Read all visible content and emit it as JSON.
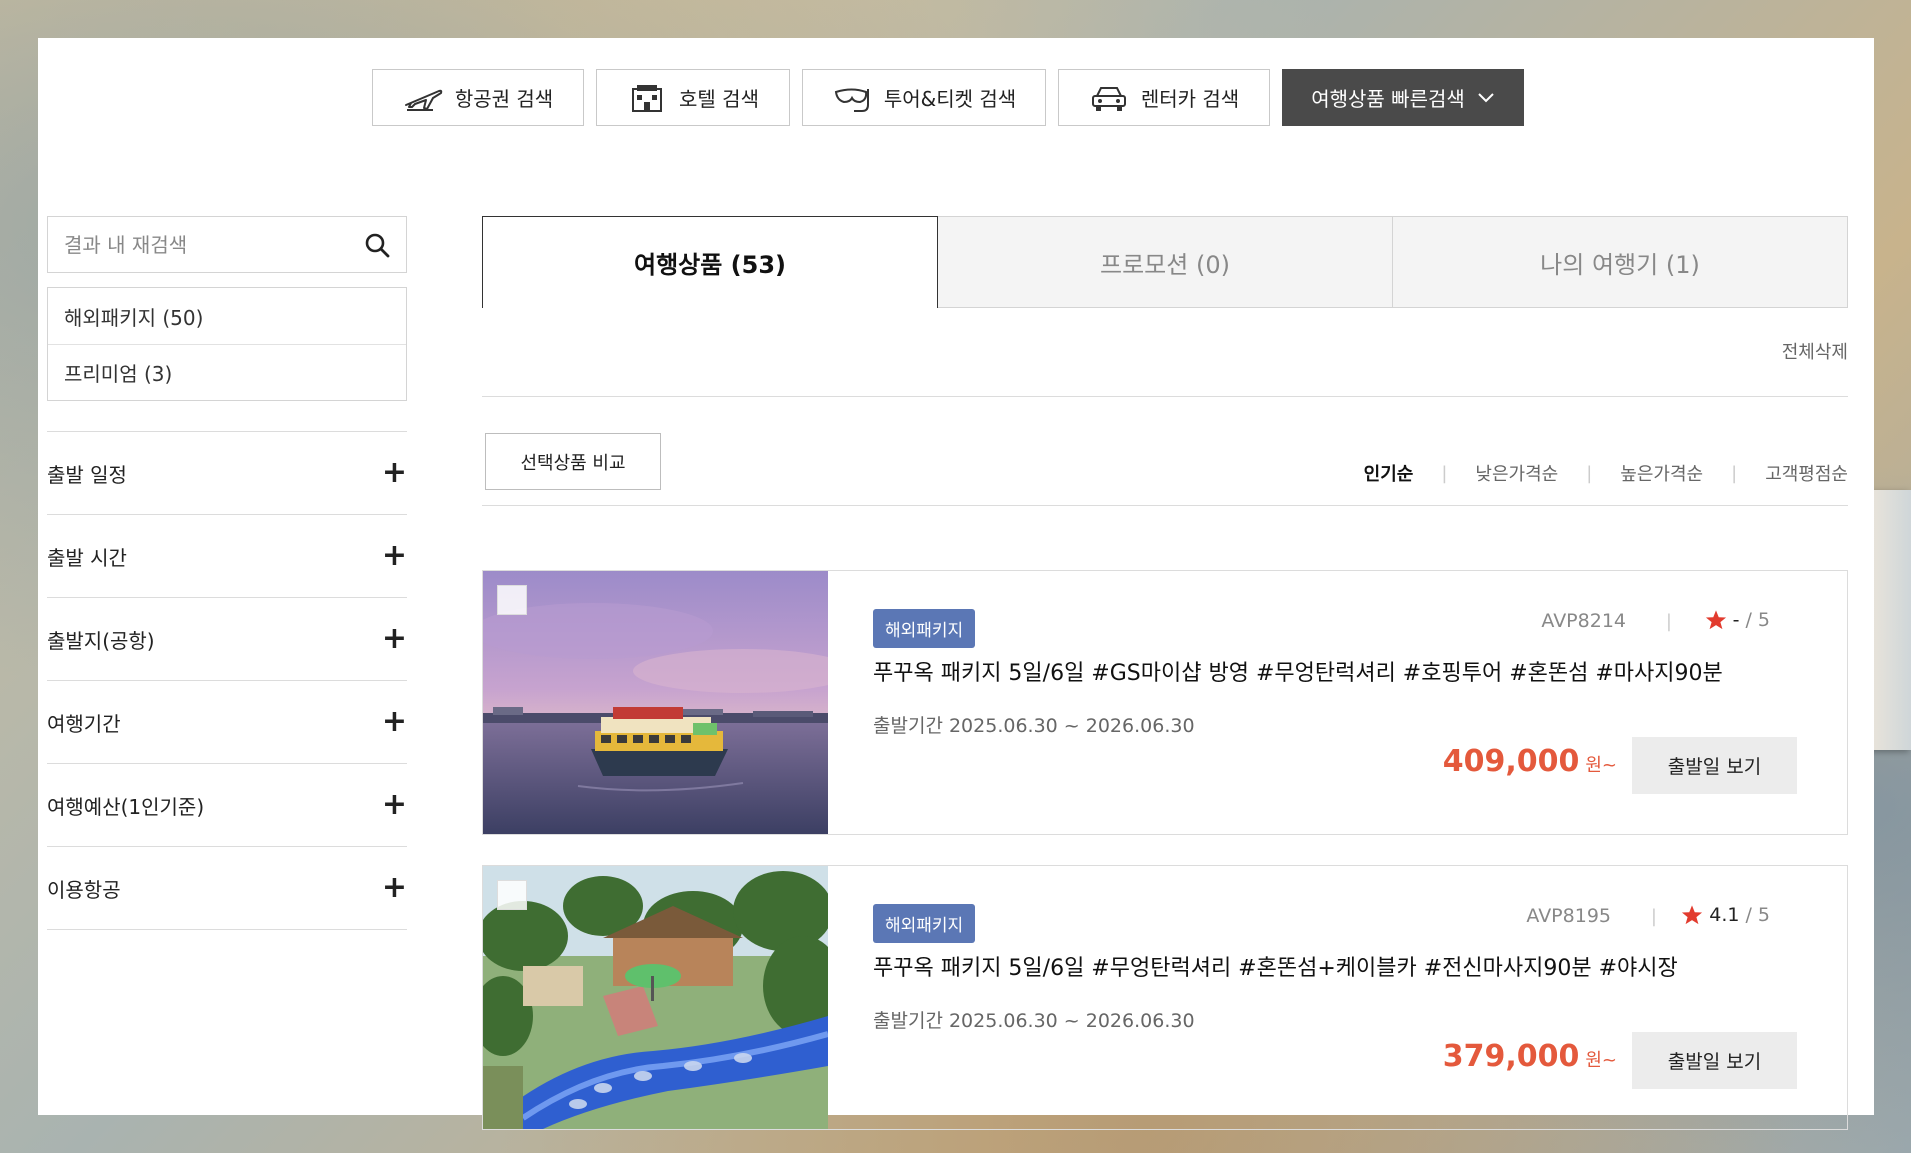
{
  "topnav": {
    "flight": "항공권 검색",
    "hotel": "호텔 검색",
    "tour": "투어&티켓 검색",
    "rentcar": "렌터카 검색",
    "quick": "여행상품 빠른검색"
  },
  "sidebar": {
    "search_placeholder": "결과 내 재검색",
    "categories": [
      {
        "label": "해외패키지 (50)"
      },
      {
        "label": "프리미엄 (3)"
      }
    ],
    "filters": [
      {
        "label": "출발 일정"
      },
      {
        "label": "출발 시간"
      },
      {
        "label": "출발지(공항)"
      },
      {
        "label": "여행기간"
      },
      {
        "label": "여행예산(1인기준)"
      },
      {
        "label": "이용항공"
      }
    ],
    "expand_symbol": "+"
  },
  "main": {
    "tabs": [
      {
        "label": "여행상품 (53)",
        "active": true
      },
      {
        "label": "프로모션 (0)",
        "active": false
      },
      {
        "label": "나의 여행기 (1)",
        "active": false
      }
    ],
    "delete_all": "전체삭제",
    "compare_label": "선택상품 비교",
    "sort": [
      {
        "label": "인기순",
        "active": true
      },
      {
        "label": "낮은가격순",
        "active": false
      },
      {
        "label": "높은가격순",
        "active": false
      },
      {
        "label": "고객평점순",
        "active": false
      }
    ]
  },
  "products": [
    {
      "badge": "해외패키지",
      "code": "AVP8214",
      "rating_score": "-",
      "rating_max": "/ 5",
      "title": "푸꾸옥 패키지 5일/6일 #GS마이샵 방영 #무엉탄럭셔리 #호핑투어 #혼똔섬 #마사지90분",
      "period": "출발기간 2025.06.30 ~ 2026.06.30",
      "price": "409,000",
      "unit": "원~",
      "button": "출발일 보기"
    },
    {
      "badge": "해외패키지",
      "code": "AVP8195",
      "rating_score": "4.1",
      "rating_max": "/ 5",
      "title": "푸꾸옥 패키지 5일/6일 #무엉탄럭셔리 #혼똔섬+케이블카 #전신마사지90분 #야시장",
      "period": "출발기간 2025.06.30 ~ 2026.06.30",
      "price": "379,000",
      "unit": "원~",
      "button": "출발일 보기"
    }
  ],
  "colors": {
    "price": "#e4593c",
    "badge": "#5b77b5",
    "star": "#e23b2e",
    "quick_search_bg": "#4a4a4a"
  }
}
